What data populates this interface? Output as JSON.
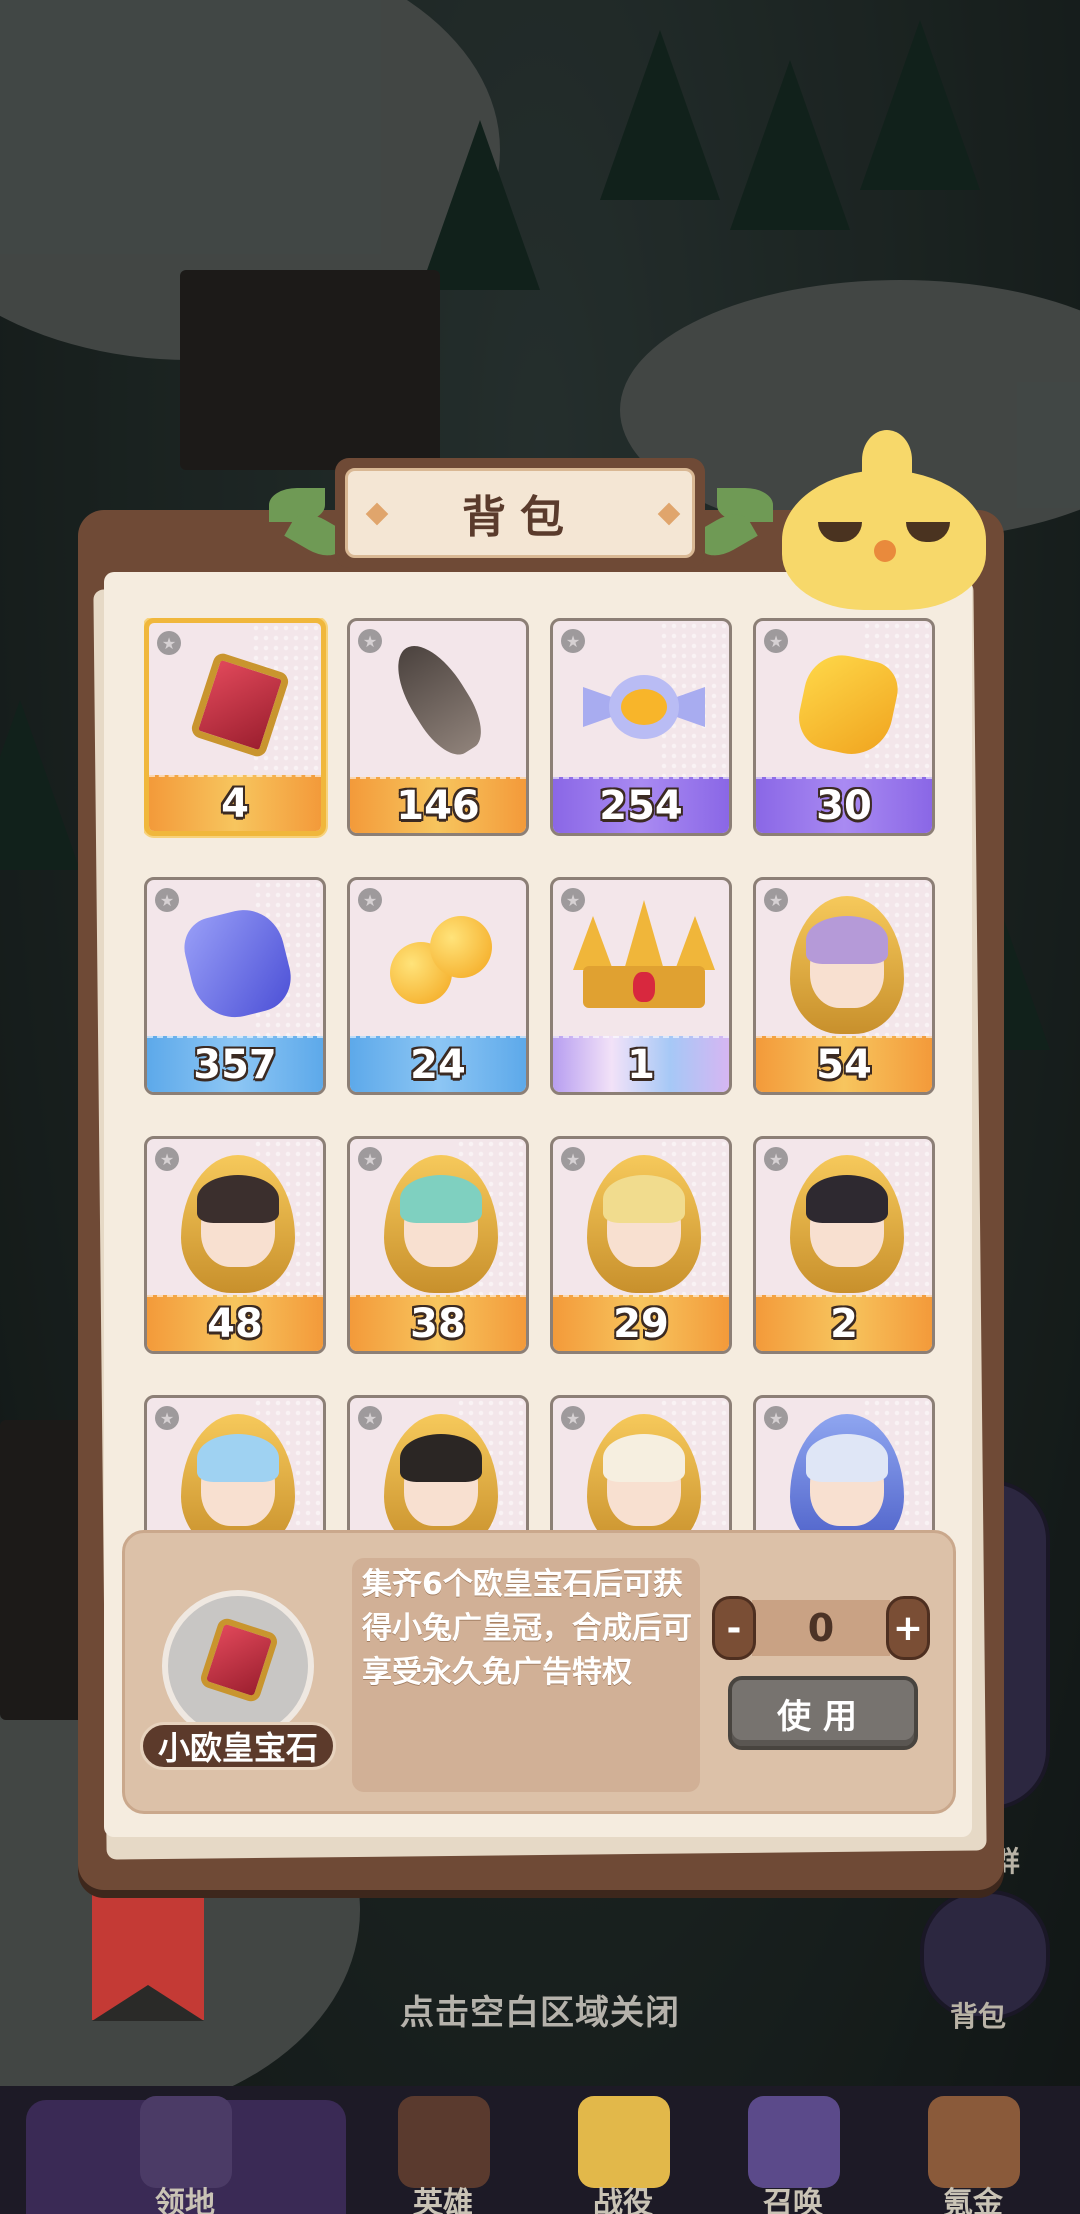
{
  "panel": {
    "title": "背包"
  },
  "items": [
    {
      "count": "4",
      "kind": "red-gem-icon",
      "bar": "orange",
      "selected": true
    },
    {
      "count": "146",
      "kind": "feather-icon",
      "bar": "orange"
    },
    {
      "count": "254",
      "kind": "candy-icon",
      "bar": "purple"
    },
    {
      "count": "30",
      "kind": "gold-ore-icon",
      "bar": "purple"
    },
    {
      "count": "357",
      "kind": "blue-crystal-icon",
      "bar": "blue"
    },
    {
      "count": "24",
      "kind": "gold-bean-icon",
      "bar": "blue"
    },
    {
      "count": "1",
      "kind": "crown-icon",
      "bar": "rainbow"
    },
    {
      "count": "54",
      "kind": "hero-shard-icon",
      "bar": "orange",
      "hair": "#b59ad8"
    },
    {
      "count": "48",
      "kind": "hero-shard-icon",
      "bar": "orange",
      "hair": "#3b2f2d"
    },
    {
      "count": "38",
      "kind": "hero-shard-icon",
      "bar": "orange",
      "hair": "#7fd0c0"
    },
    {
      "count": "29",
      "kind": "hero-shard-icon",
      "bar": "orange",
      "hair": "#f1dc8e"
    },
    {
      "count": "2",
      "kind": "hero-shard-icon",
      "bar": "orange",
      "hair": "#2e2930"
    },
    {
      "count": "",
      "kind": "hero-shard-icon",
      "bar": "orange",
      "hair": "#9fd2f2"
    },
    {
      "count": "",
      "kind": "hero-shard-icon",
      "bar": "orange",
      "hair": "#2b2624"
    },
    {
      "count": "",
      "kind": "hero-shard-icon",
      "bar": "orange",
      "hair": "#f6efe0"
    },
    {
      "count": "",
      "kind": "hero-shard-icon",
      "bar": "blue",
      "hair": "#dfe6f6"
    }
  ],
  "detail": {
    "name": "小欧皇宝石",
    "description": "集齐6个欧皇宝石后可获得小兔广皇冠，合成后可享受永久免广告特权",
    "quantity": "0",
    "minus": "-",
    "plus": "+",
    "use_label": "使用"
  },
  "close_hint": "点击空白区域关闭",
  "side_buttons": {
    "group_label": "Q群",
    "bag_label": "背包"
  },
  "bottom_nav": [
    {
      "label": "领地"
    },
    {
      "label": "英雄"
    },
    {
      "label": "战役"
    },
    {
      "label": "召唤"
    },
    {
      "label": "氪金"
    }
  ],
  "colors": {
    "panel_brown": "#6f4a36",
    "page_cream": "#f5ecdf",
    "selected_border": "#f0b73c",
    "use_button_grey": "#77736f"
  }
}
